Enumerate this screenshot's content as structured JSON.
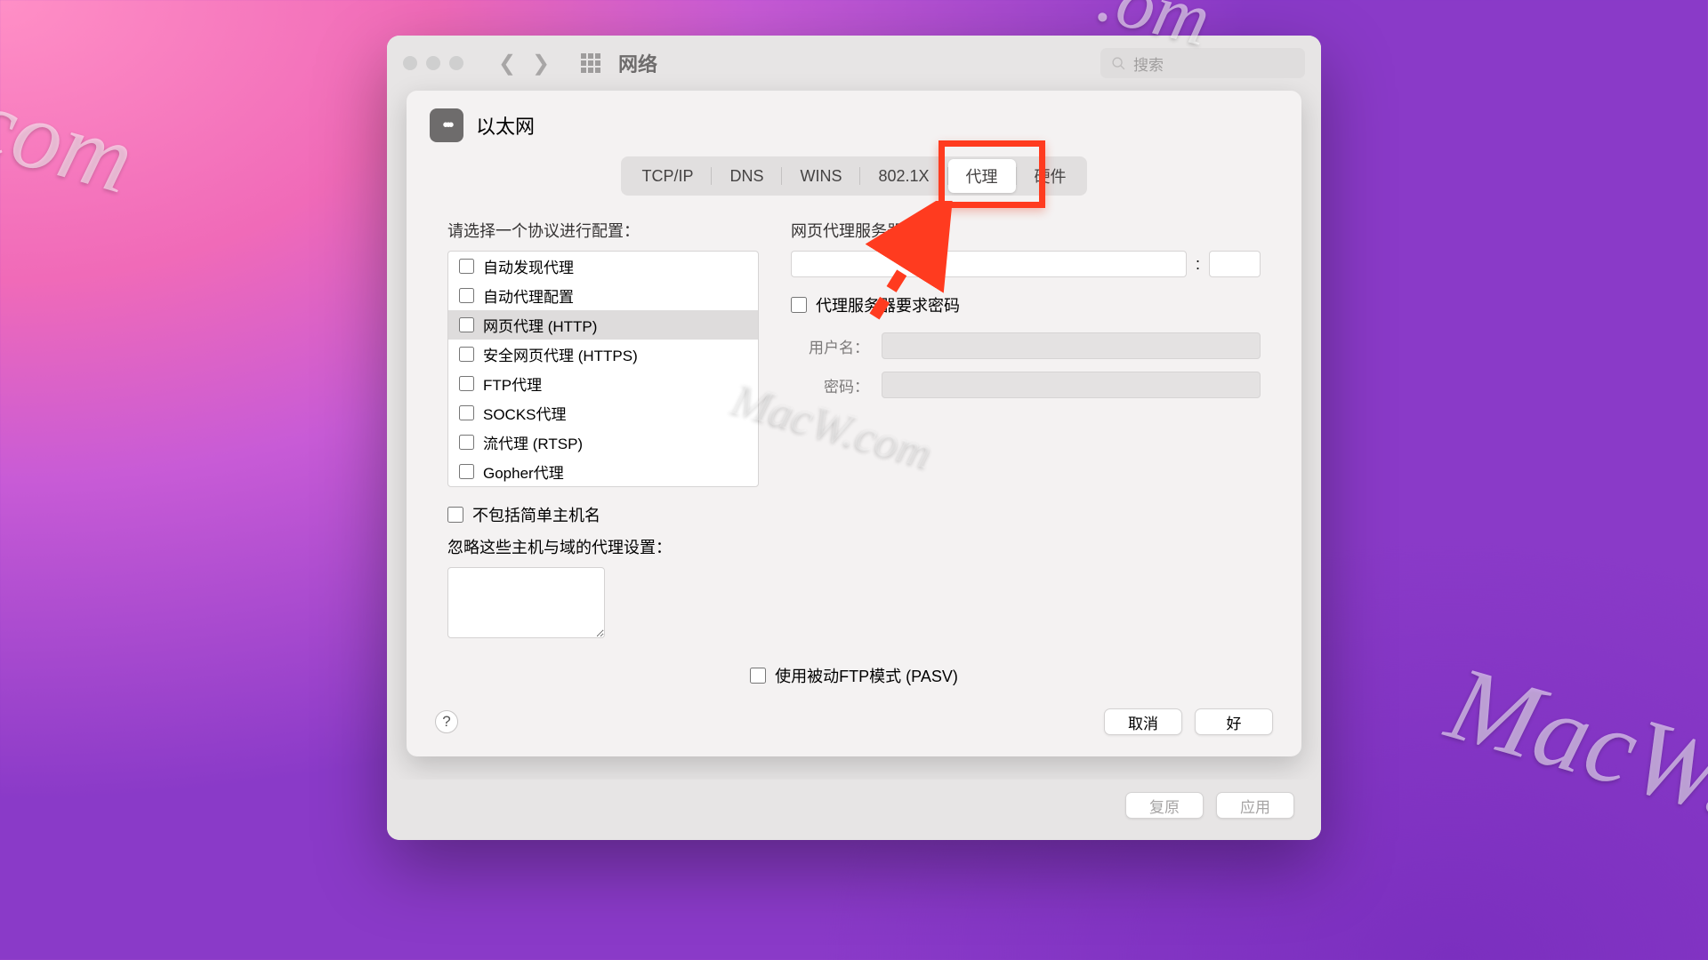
{
  "watermarks": {
    "w1": ".com",
    "w2": "MacW.c",
    "w3": "MacW.com",
    "w4": ".om"
  },
  "window": {
    "title": "网络",
    "search_placeholder": "搜索"
  },
  "sheet": {
    "title": "以太网",
    "tabs": [
      "TCP/IP",
      "DNS",
      "WINS",
      "802.1X",
      "代理",
      "硬件"
    ],
    "active_tab_index": 4,
    "left_label": "请选择一个协议进行配置：",
    "protocols": [
      {
        "label": "自动发现代理",
        "checked": false,
        "selected": false
      },
      {
        "label": "自动代理配置",
        "checked": false,
        "selected": false
      },
      {
        "label": "网页代理 (HTTP)",
        "checked": false,
        "selected": true
      },
      {
        "label": "安全网页代理 (HTTPS)",
        "checked": false,
        "selected": false
      },
      {
        "label": "FTP代理",
        "checked": false,
        "selected": false
      },
      {
        "label": "SOCKS代理",
        "checked": false,
        "selected": false
      },
      {
        "label": "流代理 (RTSP)",
        "checked": false,
        "selected": false
      },
      {
        "label": "Gopher代理",
        "checked": false,
        "selected": false
      }
    ],
    "server_label": "网页代理服务器",
    "server_host": "",
    "server_port": "",
    "require_password_label": "代理服务器要求密码",
    "username_label": "用户名：",
    "password_label": "密码：",
    "exclude_simple_label": "不包括简单主机名",
    "bypass_label": "忽略这些主机与域的代理设置：",
    "bypass_value": "",
    "pasv_label": "使用被动FTP模式 (PASV)",
    "cancel": "取消",
    "ok": "好"
  },
  "outer_footer": {
    "revert": "复原",
    "apply": "应用"
  }
}
